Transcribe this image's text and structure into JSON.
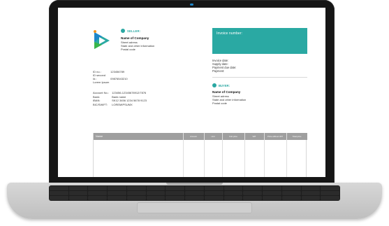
{
  "invoice": {
    "seller": {
      "heading": "SELLER:",
      "company": "Name of Company",
      "address_lines": [
        "Street adress",
        "State and other information",
        "Postal code"
      ]
    },
    "invoice_number_label": "Invoice number:",
    "dates": [
      "Invoice date:",
      "Supply date:",
      "Payment due date:",
      "Payment:"
    ],
    "buyer": {
      "heading": "BUYER:",
      "company": "Name of Company",
      "address_lines": [
        "Street adress",
        "State and other information",
        "Postal code"
      ]
    },
    "ids": [
      {
        "label": "ID no.:",
        "value": "123456789"
      },
      {
        "label": "ID second Id.:",
        "value": "09876543210"
      },
      {
        "label": "Lorem Ipsum",
        "value": ""
      }
    ],
    "bank": [
      {
        "label": "Account No.:",
        "value": "123456-12345678912/7876"
      },
      {
        "label": "Bank:",
        "value": "Bank name"
      },
      {
        "label": "IBAN:",
        "value": "SK12 3456 1234 5678 9123"
      },
      {
        "label": "BIC/SWIFT:",
        "value": "LOREMIPSUMX"
      }
    ],
    "table_headers": [
      "Name",
      "Amount",
      "Unit",
      "Unit price",
      "VAT",
      "Price without VAT",
      "Total price"
    ]
  },
  "colors": {
    "accent": "#2aa9a3",
    "table_header": "#9f9f9f",
    "laptop_frame": "#161616",
    "camera": "#1f86c9"
  }
}
